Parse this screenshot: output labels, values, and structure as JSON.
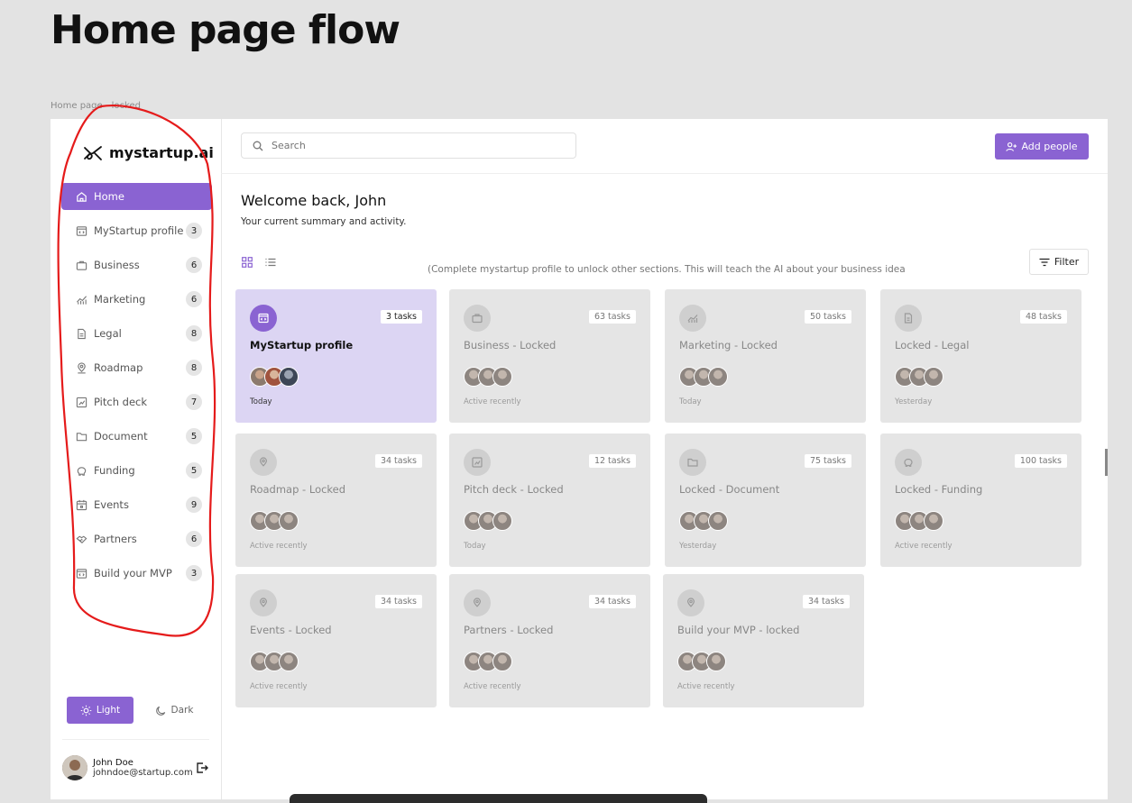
{
  "page_title": "Home page flow",
  "frame_label": "Home page - locked",
  "logo": {
    "text": "mystartup.ai"
  },
  "nav": [
    {
      "label": "Home",
      "count": "",
      "icon": "home-icon",
      "active": true
    },
    {
      "label": "MyStartup profile",
      "count": "3",
      "icon": "code-window-icon"
    },
    {
      "label": "Business",
      "count": "6",
      "icon": "briefcase-icon"
    },
    {
      "label": "Marketing",
      "count": "6",
      "icon": "chart-icon"
    },
    {
      "label": "Legal",
      "count": "8",
      "icon": "document-icon"
    },
    {
      "label": "Roadmap",
      "count": "8",
      "icon": "location-pin-icon"
    },
    {
      "label": "Pitch deck",
      "count": "7",
      "icon": "presentation-icon"
    },
    {
      "label": "Document",
      "count": "5",
      "icon": "folder-icon"
    },
    {
      "label": "Funding",
      "count": "5",
      "icon": "piggy-bank-icon"
    },
    {
      "label": "Events",
      "count": "9",
      "icon": "calendar-icon"
    },
    {
      "label": "Partners",
      "count": "6",
      "icon": "handshake-icon"
    },
    {
      "label": "Build your MVP",
      "count": "3",
      "icon": "code-window-icon"
    }
  ],
  "theme": {
    "light": "Light",
    "dark": "Dark"
  },
  "user": {
    "name": "John Doe",
    "email": "johndoe@startup.com"
  },
  "search": {
    "placeholder": "Search"
  },
  "add_people": "Add people",
  "welcome": "Welcome back, John",
  "subtitle": "Your current summary and activity.",
  "notice": "(Complete mystartup profile to unlock other sections. This will teach the AI about your business idea",
  "filter": "Filter",
  "cards": [
    {
      "title": "MyStartup profile",
      "tasks": "3 tasks",
      "time": "Today",
      "active": true,
      "icon": "code-window-icon"
    },
    {
      "title": "Business - Locked",
      "tasks": "63 tasks",
      "time": "Active recently",
      "icon": "briefcase-icon"
    },
    {
      "title": "Marketing - Locked",
      "tasks": "50 tasks",
      "time": "Today",
      "icon": "chart-icon"
    },
    {
      "title": "Locked - Legal",
      "tasks": "48 tasks",
      "time": "Yesterday",
      "icon": "document-icon"
    },
    {
      "title": "Roadmap - Locked",
      "tasks": "34 tasks",
      "time": "Active recently",
      "icon": "location-pin-icon"
    },
    {
      "title": "Pitch deck - Locked",
      "tasks": "12 tasks",
      "time": "Today",
      "icon": "presentation-icon"
    },
    {
      "title": "Locked - Document",
      "tasks": "75 tasks",
      "time": "Yesterday",
      "icon": "folder-icon"
    },
    {
      "title": "Locked - Funding",
      "tasks": "100 tasks",
      "time": "Active recently",
      "icon": "piggy-bank-icon"
    },
    {
      "title": "Events - Locked",
      "tasks": "34 tasks",
      "time": "Active recently",
      "icon": "location-pin-icon"
    },
    {
      "title": "Partners - Locked",
      "tasks": "34 tasks",
      "time": "Active recently",
      "icon": "location-pin-icon"
    },
    {
      "title": "Build your MVP - locked",
      "tasks": "34 tasks",
      "time": "Active recently",
      "icon": "location-pin-icon"
    }
  ],
  "colors": {
    "accent": "#8a63d2",
    "active_card": "#dcd5f3",
    "locked_card": "#e5e5e5",
    "annotation": "#e51b1b"
  }
}
